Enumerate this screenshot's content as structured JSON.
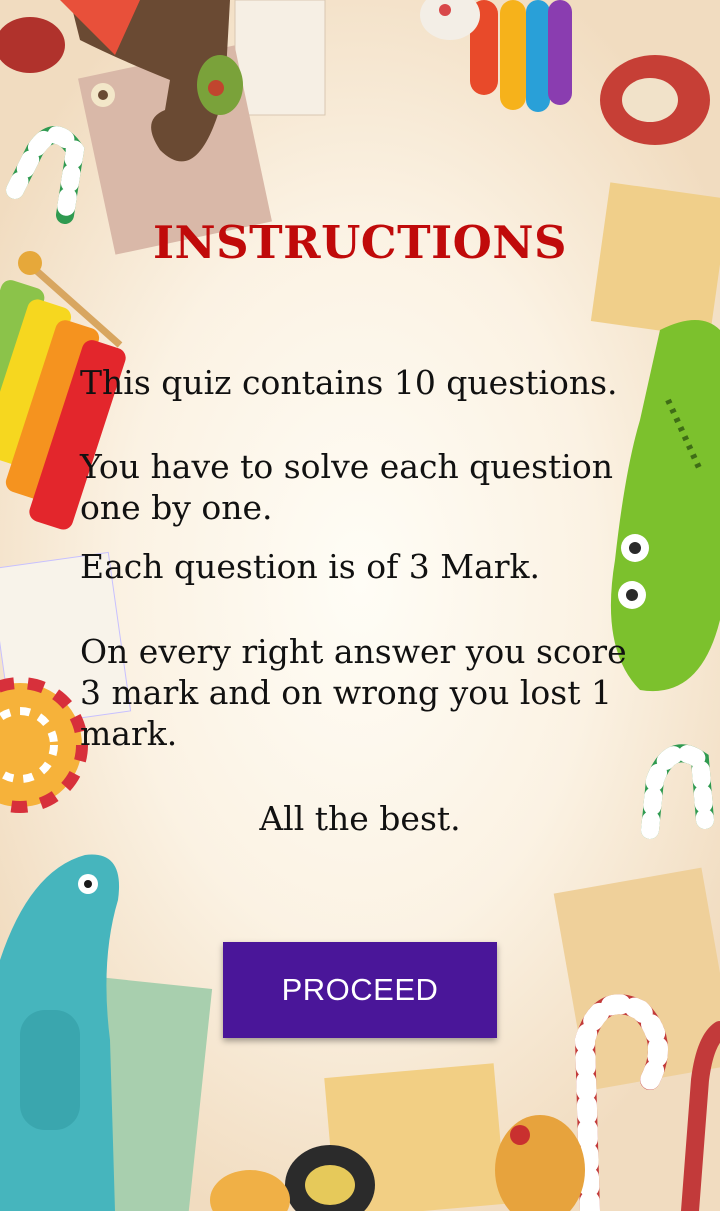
{
  "screen": {
    "title": "INSTRUCTIONS",
    "instructions": [
      "This quiz contains 10 questions.",
      "You have to solve each question one by one.",
      "Each question is of 3 Mark.",
      "On every right answer you score 3 mark and on wrong you lost 1 mark."
    ],
    "closing": "All the best.",
    "proceed_label": "PROCEED"
  },
  "colors": {
    "title": "#c00a0a",
    "button": "#4a1699",
    "button_text": "#ffffff"
  },
  "decorations": [
    "candy-cane-icon",
    "xylophone-icon",
    "crocodile-toy-icon",
    "lollipop-icon",
    "dinosaur-toy-icon",
    "ribbon-bow-icon",
    "notepaper-icon"
  ]
}
